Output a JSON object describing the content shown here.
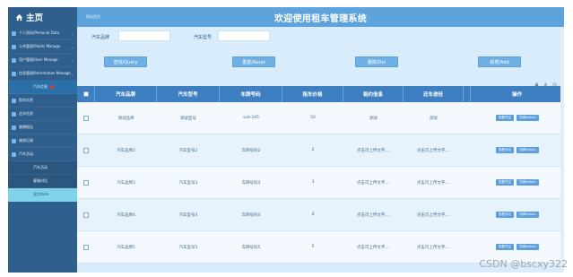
{
  "sidebar": {
    "brand": "主页",
    "items": [
      {
        "label": "个人资料/Personal Data",
        "type": "group"
      },
      {
        "label": "公共管理/Public Manage",
        "type": "group"
      },
      {
        "label": "用户管理/User Manage",
        "type": "group"
      },
      {
        "label": "信息管理/Information Manage",
        "type": "group"
      },
      {
        "label": "汽车信息",
        "type": "sub"
      },
      {
        "label": "租车信息",
        "type": "group"
      },
      {
        "label": "还车信息",
        "type": "group"
      },
      {
        "label": "故障报告",
        "type": "group"
      },
      {
        "label": "维修记录",
        "type": "group"
      },
      {
        "label": "汽车活动",
        "type": "group"
      },
      {
        "label": "汽车活动",
        "type": "sub"
      },
      {
        "label": "客服对话",
        "type": "sub"
      },
      {
        "label": "留言Note",
        "type": "active"
      }
    ],
    "overlay_text": "高級信息"
  },
  "header": {
    "breadcrumb": "网站首页",
    "title": "欢迎使用租车管理系统"
  },
  "search": {
    "brand_label": "汽车品牌",
    "model_label": "汽车型号"
  },
  "buttons": {
    "query": "查询/Query",
    "reset": "重置/Reset",
    "delete": "删除/Del",
    "add": "新增/Add"
  },
  "table": {
    "columns": [
      "汽车品牌",
      "汽车型号",
      "车牌号码",
      "租车价格",
      "租约信息",
      "还车途径",
      "",
      "操作"
    ],
    "rows": [
      [
        "测试品牌",
        "测试型号",
        "ssd-345",
        "50",
        "测试",
        "测试"
      ],
      [
        "汽车品牌2",
        "汽车型号2",
        "车牌号码2",
        "2",
        "点击可上传文字,...",
        "点击可上传文字,..."
      ],
      [
        "汽车品牌3",
        "汽车型号3",
        "车牌号码3",
        "3",
        "点击可上传文字,...",
        "点击可上传文字,..."
      ],
      [
        "汽车品牌4",
        "汽车型号4",
        "车牌号码4",
        "4",
        "点击可上传文字,...",
        "点击可上传文字,..."
      ],
      [
        "汽车品牌5",
        "汽车型号5",
        "车牌号码5",
        "5",
        "点击可上传文字,...",
        "点击可上传文字,..."
      ]
    ],
    "op_view": "查看评论",
    "op_detail": "详情Details"
  },
  "watermark": "CSDN @bscxy322",
  "colors": {
    "sidebar": "#2f5f8c",
    "header": "#5fa3dc",
    "table_head": "#3d7fc1",
    "button": "#6eb0e6"
  }
}
